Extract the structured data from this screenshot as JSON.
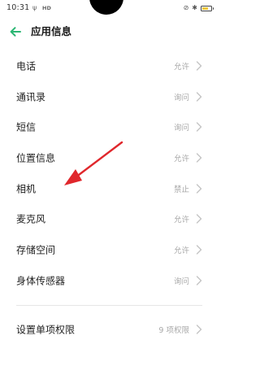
{
  "status_bar": {
    "time": "10:31",
    "wifi_glyph": "ψ",
    "network": "HD",
    "vibrate_glyph": "⊘",
    "bluetooth_glyph": "✱",
    "battery_level": 0.7,
    "battery_color": "#f0c53a"
  },
  "header": {
    "back_icon": "back-arrow-icon",
    "title": "应用信息",
    "accent_color": "#2bb673"
  },
  "permissions": [
    {
      "label": "电话",
      "value": "允许"
    },
    {
      "label": "通讯录",
      "value": "询问"
    },
    {
      "label": "短信",
      "value": "询问"
    },
    {
      "label": "位置信息",
      "value": "允许"
    },
    {
      "label": "相机",
      "value": "禁止"
    },
    {
      "label": "麦克风",
      "value": "允许"
    },
    {
      "label": "存储空间",
      "value": "允许"
    },
    {
      "label": "身体传感器",
      "value": "询问"
    }
  ],
  "single_permission": {
    "label": "设置单项权限",
    "value": "9 项权限"
  },
  "annotation": {
    "icon": "red-arrow-pointer",
    "color": "#e0272c"
  }
}
